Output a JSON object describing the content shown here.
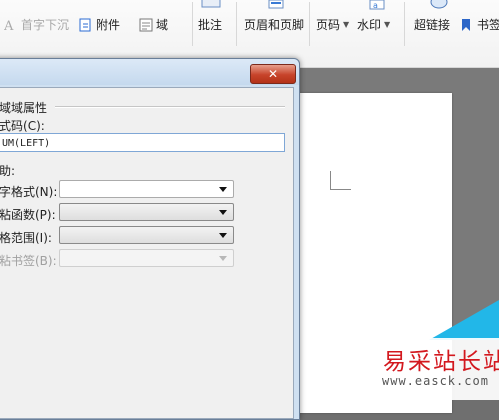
{
  "ribbon": {
    "first_line_indent": "首字下沉",
    "attachment": "附件",
    "field": "域",
    "comment": "批注",
    "header_footer": "页眉和页脚",
    "page_number": "页码",
    "watermark": "水印",
    "hyperlink": "超链接",
    "bookmark": "书签"
  },
  "dialog": {
    "close": "✕",
    "group_title": "域属性",
    "group_prefix": "域",
    "code_label": "域代码(C):",
    "code_prefix": "式码",
    "code_value": "UM(LEFT)",
    "section_label": "助:",
    "number_format_label": "字格式(N):",
    "paste_function_label": "粘函数(P):",
    "range_label": "格范围(I):",
    "bookmark_label": "粘书签(B):"
  },
  "watermark": {
    "site_name": "易采站长站",
    "url": "www.easck.com"
  }
}
